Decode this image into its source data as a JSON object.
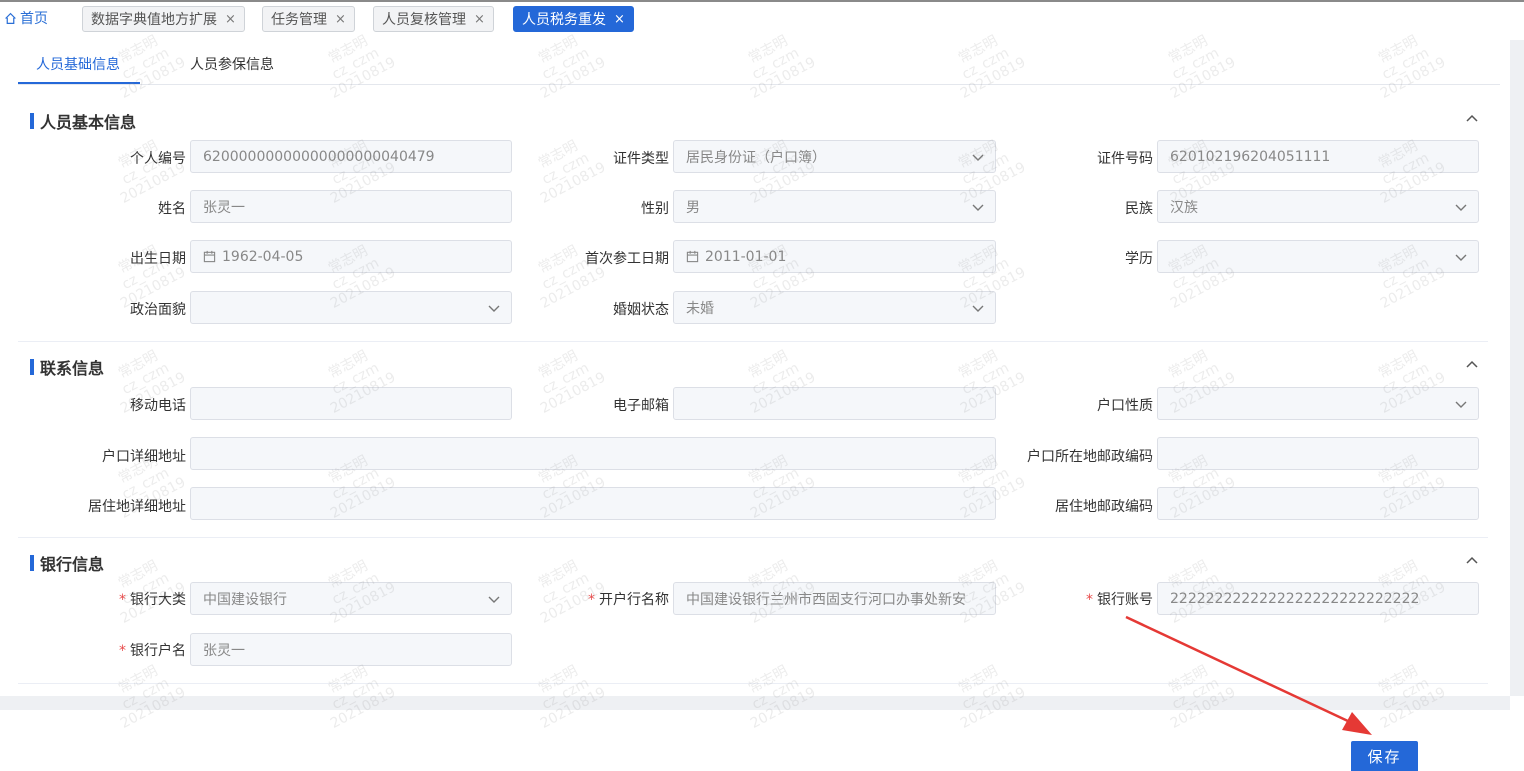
{
  "page_tabs": {
    "home": "首页",
    "tabs": [
      {
        "label": "数据字典值地方扩展"
      },
      {
        "label": "任务管理"
      },
      {
        "label": "人员复核管理"
      },
      {
        "label": "人员税务重发"
      }
    ],
    "close": "×"
  },
  "sub_tabs": [
    "人员基础信息",
    "人员参保信息"
  ],
  "sections": {
    "basic": {
      "title": "人员基本信息"
    },
    "contact": {
      "title": "联系信息"
    },
    "bank": {
      "title": "银行信息"
    }
  },
  "basic": {
    "personal_id": {
      "label": "个人编号",
      "value": "62000000000000000000040479"
    },
    "id_type": {
      "label": "证件类型",
      "value": "居民身份证（户口簿）"
    },
    "id_number": {
      "label": "证件号码",
      "value": "620102196204051111"
    },
    "name": {
      "label": "姓名",
      "value": "张灵一"
    },
    "gender": {
      "label": "性别",
      "value": "男"
    },
    "ethnicity": {
      "label": "民族",
      "value": "汉族"
    },
    "birth_date": {
      "label": "出生日期",
      "value": "1962-04-05"
    },
    "first_work_date": {
      "label": "首次参工日期",
      "value": "2011-01-01"
    },
    "education": {
      "label": "学历",
      "value": ""
    },
    "political_status": {
      "label": "政治面貌",
      "value": ""
    },
    "marital_status": {
      "label": "婚姻状态",
      "value": "未婚"
    }
  },
  "contact": {
    "mobile": {
      "label": "移动电话",
      "value": ""
    },
    "email": {
      "label": "电子邮箱",
      "value": ""
    },
    "hukou_type": {
      "label": "户口性质",
      "value": ""
    },
    "hukou_address": {
      "label": "户口详细地址",
      "value": ""
    },
    "hukou_postcode": {
      "label": "户口所在地邮政编码",
      "value": ""
    },
    "residence_address": {
      "label": "居住地详细地址",
      "value": ""
    },
    "residence_postcode": {
      "label": "居住地邮政编码",
      "value": ""
    }
  },
  "bank": {
    "bank_category": {
      "label": "银行大类",
      "value": "中国建设银行"
    },
    "branch_name": {
      "label": "开户行名称",
      "value": "中国建设银行兰州市西固支行河口办事处新安"
    },
    "account_number": {
      "label": "银行账号",
      "value": "2222222222222222222222222222"
    },
    "account_name": {
      "label": "银行户名",
      "value": "张灵一"
    }
  },
  "required_mark": "*",
  "watermark": {
    "line1": "常志明",
    "line2": "cz_czm",
    "line3": "20210819"
  },
  "actions": {
    "save": "保存"
  },
  "colors": {
    "primary": "#2468d8",
    "required": "#e84b4b",
    "annotation_arrow": "#e53935"
  }
}
